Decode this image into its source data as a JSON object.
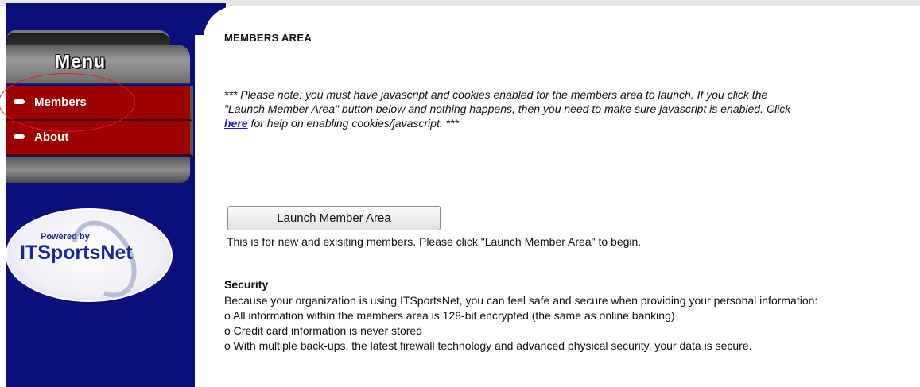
{
  "sidebar": {
    "menu_title": "Menu",
    "items": [
      {
        "label": "Members"
      },
      {
        "label": "About"
      }
    ],
    "logo": {
      "powered_by": "Powered by",
      "brand": "ITSportsNet"
    }
  },
  "main": {
    "title": "MEMBERS AREA",
    "note_before_link": "*** Please note: you must have javascript and cookies enabled for the members area to launch. If you click the \"Launch Member Area\" button below and nothing happens, then you need to make sure javascript is enabled. Click ",
    "note_link": "here",
    "note_after_link": " for help on enabling cookies/javascript. ***",
    "launch_button": "Launch Member Area",
    "launch_description": "This is for new and exisiting members. Please click \"Launch Member Area\" to begin.",
    "security": {
      "title": "Security",
      "intro": "Because your organization is using ITSportsNet, you can feel safe and secure when providing your personal information:",
      "points": [
        "o All information within the members area is 128-bit encrypted (the same as online banking)",
        "o Credit card information is never stored",
        "o With multiple back-ups, the latest firewall technology and advanced physical security, your data is secure."
      ]
    }
  },
  "colors": {
    "sidebar_bg": "#0a0f7a",
    "menu_item_bg": "#9c0000",
    "link": "#1a1acc",
    "highlight_circle": "#e81a1a"
  }
}
